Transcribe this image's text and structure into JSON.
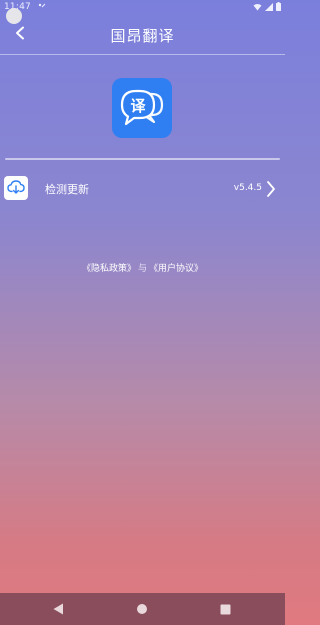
{
  "status_bar": {
    "time": "11:47"
  },
  "header": {
    "title": "国昂翻译"
  },
  "about": {
    "logo_glyph": "译",
    "update_label": "检测更新",
    "version": "v5.4.5"
  },
  "policy": {
    "privacy_label": "《隐私政策》",
    "and_text": "与",
    "agreement_label": "《用户协议》"
  },
  "icons": {
    "back": "back-arrow-icon",
    "update": "cloud-download-icon",
    "chevron": "chevron-right-icon",
    "nav_back": "triangle-back-icon",
    "nav_home": "circle-home-icon",
    "nav_recents": "square-recents-icon"
  },
  "colors": {
    "logo_bg": "#2f7ff2",
    "gradient_top": "#7b7fdc",
    "gradient_bottom": "#e07a80",
    "nav_bar": "#8a4d5b",
    "update_icon": "#2f7ff2"
  }
}
